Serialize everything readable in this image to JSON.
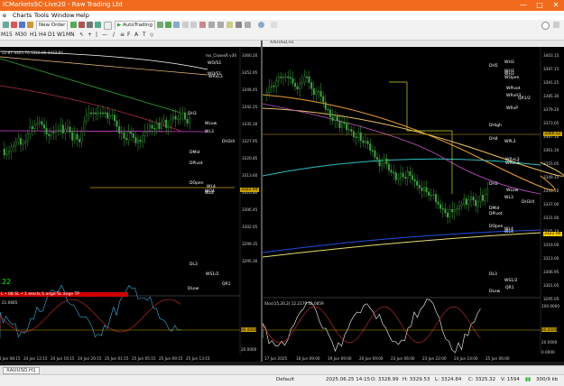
{
  "window": {
    "title": "ICMarketsSC-Live20 - Raw Trading Ltd",
    "min": "—",
    "max": "□",
    "close": "✕"
  },
  "menu": [
    "e",
    "Charts",
    "Tools",
    "Window",
    "Help"
  ],
  "toolbar": {
    "new_order": "New Order",
    "autotrading": "AutoTrading"
  },
  "timeframes": [
    "M15",
    "M30",
    "H1",
    "H4",
    "D1",
    "W1",
    "MN"
  ],
  "left_chart": {
    "header": "22.67 3325.70 3322.05 3322.94",
    "indicator_title": "ms_ClosesR v30",
    "labels": [
      "WO/S1",
      "WO/S1",
      "WRvL3",
      "DH3",
      "WLow",
      "WL3",
      "DH3/4",
      "DMid",
      "DPivot",
      "DOpen",
      "WL4",
      "WO4",
      "WL4",
      "DL3",
      "WS1/2",
      "DLow",
      "QR1"
    ],
    "prices": [
      "3360.20",
      "3352.95",
      "3349.45",
      "3342.25",
      "3335.30",
      "3327.95",
      "3320.85",
      "3313.60",
      "3310.80",
      "3306.45",
      "3302.05",
      "3299.35",
      "3295.30"
    ],
    "current_price": "3322.94",
    "green_value": "22",
    "indicator_bar": "L • 08 SL • 1 elects S  ange SL  ange TP",
    "oscillator_header": "21.0665",
    "osc_prices": [
      "80.0000",
      "20.0000"
    ],
    "dates": [
      "24 Jun 08:15",
      "24 Jun 12:15",
      "24 Jun 16:15",
      "24 Jun 20:15",
      "25 Jun 01:15",
      "25 Jun 05:15",
      "25 Jun 09:15",
      "25 Jun 13:15"
    ]
  },
  "right_chart": {
    "title": "XAUUSD,H1",
    "labels": [
      "DH5",
      "WH3",
      "WH3",
      "WH3",
      "WOpen",
      "WPivot",
      "WRvH3",
      "QR1/2",
      "WRvP",
      "DHigh",
      "DH4",
      "WPL3",
      "WRvL3",
      "WRvL3",
      "DH3",
      "WLow",
      "WL3",
      "DH3/4",
      "DMid",
      "DPivot",
      "DOpen",
      "WL4",
      "WL4",
      "DL3",
      "WS1/2",
      "DLow",
      "QR1"
    ],
    "prices": [
      "3403.15",
      "3397.15",
      "3391.25",
      "3385.30",
      "3379.20",
      "3373.05",
      "3367.10",
      "3361.10",
      "3355.05",
      "3349.15",
      "3343.10",
      "3337.00",
      "3331.00",
      "3325.10",
      "3319.00",
      "3313.00",
      "3306.95",
      "3301.05",
      "3295.05"
    ],
    "price_tag_1": "3366.52",
    "price_tag_2": "3322.94",
    "oscillator_header": "Stoc(15,20,2) 12.2179 42.0859",
    "osc_prices": [
      "100.0000",
      "80.0000",
      "20.0000",
      "0.0000"
    ],
    "dates": [
      "17 Jun 2025",
      "18 Jun 09:00",
      "19 Jun 09:00",
      "20 Jun 09:00",
      "23 Jun 06:00",
      "23 Jun 22:00",
      "24 Jun 14:00",
      "25 Jun 06:00"
    ]
  },
  "bottom_tab": "XAUUSD,H1",
  "status": {
    "profile": "Default",
    "datetime": "2025.06.25 14:15",
    "open": "O: 3328.99",
    "high": "H: 3329.53",
    "low": "L: 3324.84",
    "close": "C: 3325.32",
    "volume": "V: 1594",
    "traffic": "300/9 kb"
  }
}
